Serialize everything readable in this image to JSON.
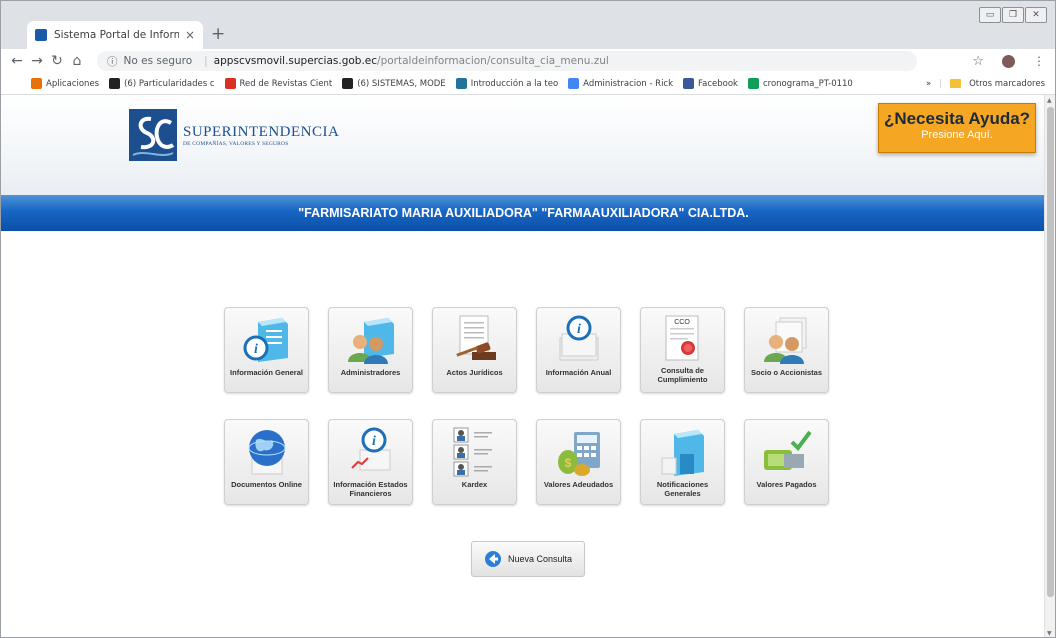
{
  "browser": {
    "tab_title": "Sistema Portal de Información S...",
    "tab_close": "×",
    "new_tab": "+",
    "security": "No es seguro",
    "url_host": "appscvsmovil.supercias.gob.ec",
    "url_path": "/portaldeinformacion/consulta_cia_menu.zul",
    "bookmarks": [
      {
        "label": "Aplicaciones",
        "icon": "apps-icon",
        "color": "#e8710a"
      },
      {
        "label": "(6) Particularidades c",
        "icon": "a-icon",
        "color": "#222222"
      },
      {
        "label": "Red de Revistas Cient",
        "icon": "redalyc-icon",
        "color": "#d93025"
      },
      {
        "label": "(6) SISTEMAS, MODE",
        "icon": "a-icon",
        "color": "#222222"
      },
      {
        "label": "Introducción a la teo",
        "icon": "wordpress-icon",
        "color": "#21759b"
      },
      {
        "label": "Administracion - Rick",
        "icon": "google-icon",
        "color": "#4285f4"
      },
      {
        "label": "Facebook",
        "icon": "facebook-icon",
        "color": "#3b5998"
      },
      {
        "label": "cronograma_PT-0110",
        "icon": "sheets-icon",
        "color": "#0f9d58"
      }
    ],
    "more_bookmarks": "»",
    "other_bookmarks": "Otros marcadores"
  },
  "header": {
    "logo_title": "SUPERINTENDENCIA",
    "logo_subtitle": "DE COMPAÑÍAS, VALORES Y SEGUROS",
    "help_title": "¿Necesita Ayuda?",
    "help_subtitle": "Presione Aquí."
  },
  "company_name": "\"FARMISARIATO MARIA AUXILIADORA\" \"FARMAAUXILIADORA\" CIA.LTDA.",
  "menu": {
    "row1": [
      {
        "label": "Información General",
        "icon": "info-building-icon"
      },
      {
        "label": "Administradores",
        "icon": "administrators-icon"
      },
      {
        "label": "Actos Jurídicos",
        "icon": "gavel-icon"
      },
      {
        "label": "Información Anual",
        "icon": "info-documents-icon"
      },
      {
        "label": "Consulta de Cumplimiento",
        "icon": "certificate-icon",
        "badge": "CCO"
      },
      {
        "label": "Socio o Accionistas",
        "icon": "shareholders-icon"
      }
    ],
    "row2": [
      {
        "label": "Documentos Online",
        "icon": "globe-documents-icon"
      },
      {
        "label": "Información Estados Financieros",
        "icon": "financial-info-icon"
      },
      {
        "label": "Kardex",
        "icon": "kardex-icon"
      },
      {
        "label": "Valores Adeudados",
        "icon": "money-calculator-icon"
      },
      {
        "label": "Notificaciones Generales",
        "icon": "notifications-icon"
      },
      {
        "label": "Valores Pagados",
        "icon": "paid-check-icon"
      }
    ]
  },
  "new_query_label": "Nueva Consulta"
}
